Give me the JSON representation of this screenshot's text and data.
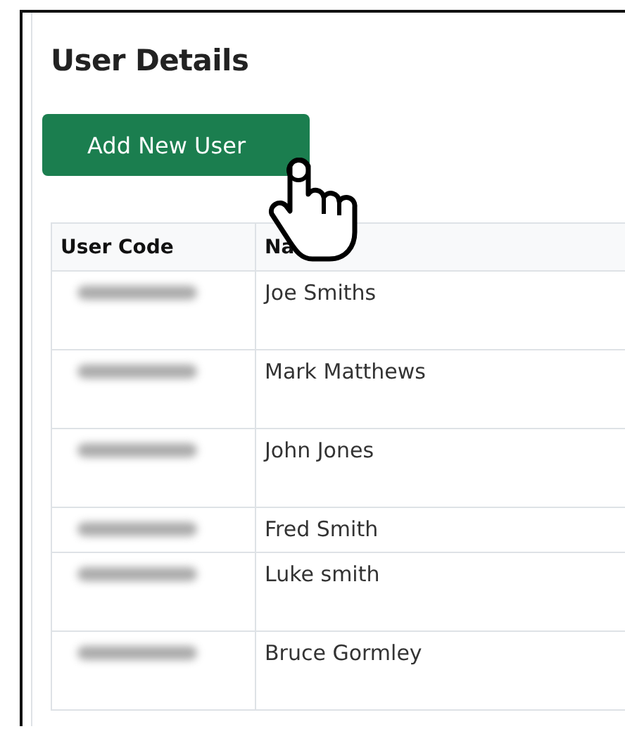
{
  "title": "User Details",
  "add_button": {
    "label": "Add New User",
    "hovered": true
  },
  "table": {
    "columns": [
      "User Code",
      "Na"
    ],
    "rows": [
      {
        "code_blurred": true,
        "name": "Joe Smiths",
        "kind": "tall"
      },
      {
        "code_blurred": true,
        "name": "Mark Matthews",
        "kind": "tall"
      },
      {
        "code_blurred": true,
        "name": "John Jones",
        "kind": "tall"
      },
      {
        "code_blurred": true,
        "name": "Fred Smith",
        "kind": "short"
      },
      {
        "code_blurred": true,
        "name": "Luke smith",
        "kind": "tall"
      },
      {
        "code_blurred": true,
        "name": "Bruce Gormley",
        "kind": "tall"
      }
    ]
  }
}
